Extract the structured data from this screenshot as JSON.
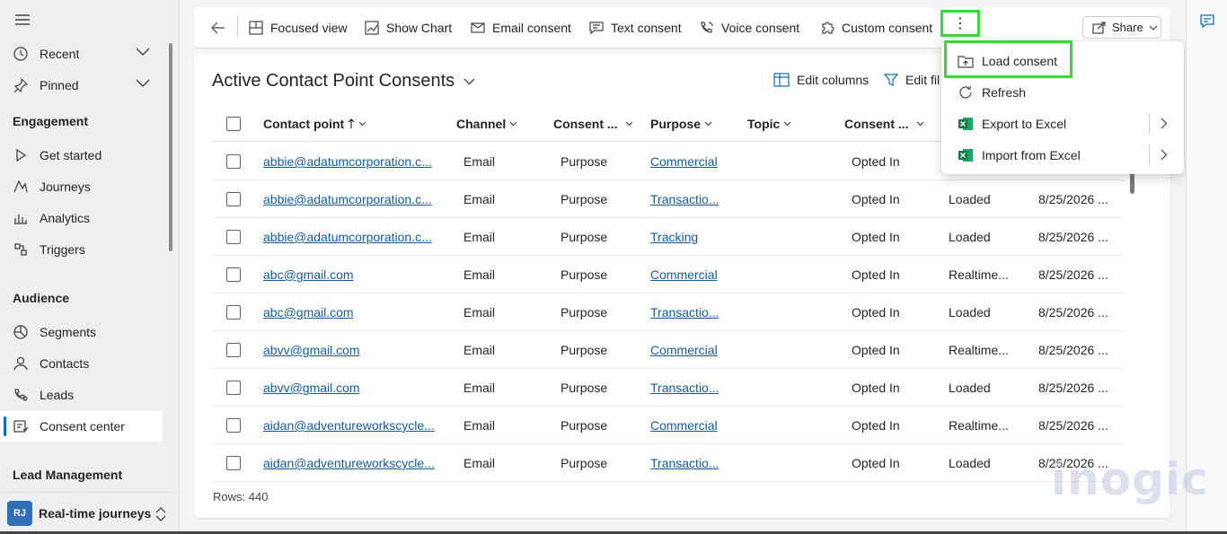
{
  "sidebar": {
    "items": [
      {
        "label": "Recent",
        "icon": "clock-icon"
      },
      {
        "label": "Pinned",
        "icon": "pin-icon"
      },
      {
        "label": "Get started",
        "icon": "play-icon"
      },
      {
        "label": "Journeys",
        "icon": "journey-icon"
      },
      {
        "label": "Analytics",
        "icon": "bar-chart-icon"
      },
      {
        "label": "Triggers",
        "icon": "trigger-icon"
      },
      {
        "label": "Segments",
        "icon": "segments-icon"
      },
      {
        "label": "Contacts",
        "icon": "person-icon"
      },
      {
        "label": "Leads",
        "icon": "phone-person-icon"
      },
      {
        "label": "Consent center",
        "icon": "consent-icon"
      }
    ],
    "groups": [
      "Engagement",
      "Audience",
      "Lead Management"
    ],
    "area": {
      "initials": "RJ",
      "label": "Real-time journeys"
    }
  },
  "commandbar": {
    "focused_view": "Focused view",
    "show_chart": "Show Chart",
    "email_consent": "Email consent",
    "text_consent": "Text consent",
    "voice_consent": "Voice consent",
    "custom_consent": "Custom consent",
    "more": "⋮",
    "share": "Share"
  },
  "view": {
    "title": "Active Contact Point Consents",
    "edit_columns": "Edit columns",
    "edit_filters": "Edit fil",
    "rows_label": "Rows: 440"
  },
  "columns": [
    "Contact point",
    "Channel",
    "Consent ...",
    "Purpose",
    "Topic",
    "Consent ..."
  ],
  "rows": [
    {
      "contact": "abbie@adatumcorporation.c...",
      "channel": "Email",
      "type": "Purpose",
      "purpose": "Commercial",
      "topic": "",
      "status": "Opted In",
      "source": "",
      "date": ""
    },
    {
      "contact": "abbie@adatumcorporation.c...",
      "channel": "Email",
      "type": "Purpose",
      "purpose": "Transactio...",
      "topic": "",
      "status": "Opted In",
      "source": "Loaded",
      "date": "8/25/2026 ..."
    },
    {
      "contact": "abbie@adatumcorporation.c...",
      "channel": "Email",
      "type": "Purpose",
      "purpose": "Tracking",
      "topic": "",
      "status": "Opted In",
      "source": "Loaded",
      "date": "8/25/2026 ..."
    },
    {
      "contact": "abc@gmail.com",
      "channel": "Email",
      "type": "Purpose",
      "purpose": "Commercial",
      "topic": "",
      "status": "Opted In",
      "source": "Realtime...",
      "date": "8/25/2026 ..."
    },
    {
      "contact": "abc@gmail.com",
      "channel": "Email",
      "type": "Purpose",
      "purpose": "Transactio...",
      "topic": "",
      "status": "Opted In",
      "source": "Loaded",
      "date": "8/25/2026 ..."
    },
    {
      "contact": "abvv@gmail.com",
      "channel": "Email",
      "type": "Purpose",
      "purpose": "Commercial",
      "topic": "",
      "status": "Opted In",
      "source": "Realtime...",
      "date": "8/25/2026 ..."
    },
    {
      "contact": "abvv@gmail.com",
      "channel": "Email",
      "type": "Purpose",
      "purpose": "Transactio...",
      "topic": "",
      "status": "Opted In",
      "source": "Loaded",
      "date": "8/25/2026 ..."
    },
    {
      "contact": "aidan@adventureworkscycle...",
      "channel": "Email",
      "type": "Purpose",
      "purpose": "Commercial",
      "topic": "",
      "status": "Opted In",
      "source": "Realtime...",
      "date": "8/25/2026 ..."
    },
    {
      "contact": "aidan@adventureworkscycle...",
      "channel": "Email",
      "type": "Purpose",
      "purpose": "Transactio...",
      "topic": "",
      "status": "Opted In",
      "source": "Loaded",
      "date": "8/25/2026 ..."
    }
  ],
  "menu": {
    "load_consent": "Load consent",
    "refresh": "Refresh",
    "export_excel": "Export to Excel",
    "import_excel": "Import from Excel"
  },
  "watermark": "inogic",
  "colors": {
    "accent": "#0f6cbd",
    "highlight": "#33dd33",
    "link": "#115ea3",
    "excel": "#107c41"
  }
}
